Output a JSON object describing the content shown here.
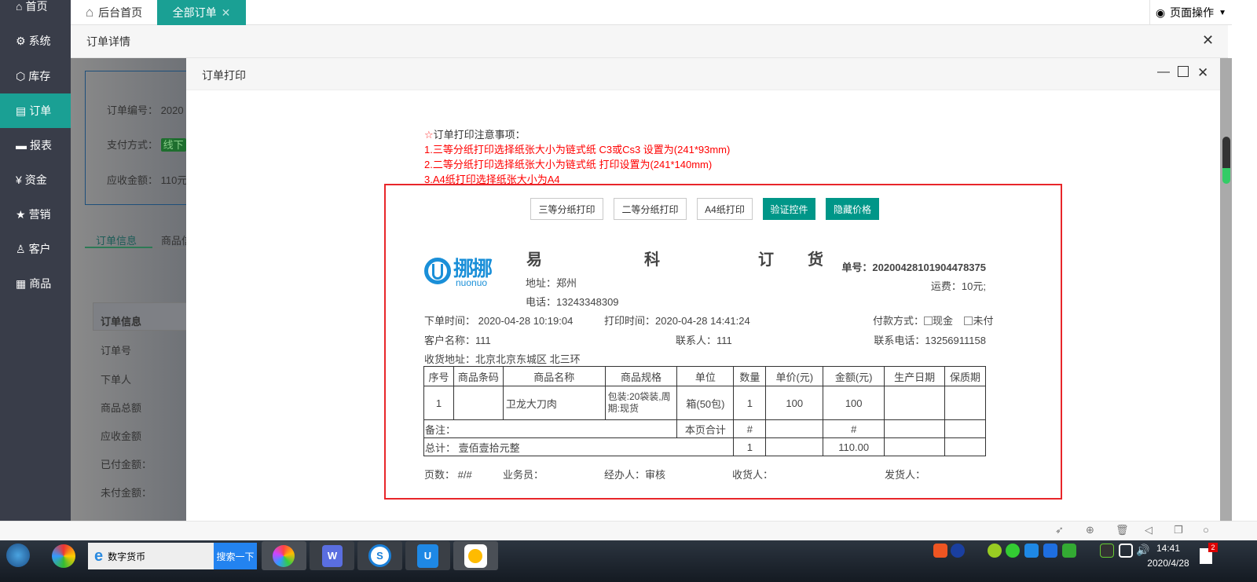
{
  "sidebar": {
    "items": [
      {
        "label": "首页",
        "icon": "home-icon"
      },
      {
        "label": "系统",
        "icon": "gear-icon"
      },
      {
        "label": "库存",
        "icon": "cube-icon"
      },
      {
        "label": "订单",
        "icon": "document-icon",
        "active": true
      },
      {
        "label": "报表",
        "icon": "monitor-icon"
      },
      {
        "label": "资金",
        "icon": "yen-icon"
      },
      {
        "label": "营销",
        "icon": "star-icon"
      },
      {
        "label": "客户",
        "icon": "user-icon"
      },
      {
        "label": "商品",
        "icon": "grid-icon"
      }
    ]
  },
  "tabs": [
    {
      "label": "后台首页"
    },
    {
      "label": "全部订单",
      "active": true
    }
  ],
  "page_ops": "页面操作",
  "subheader": "订单详情",
  "background": {
    "order_no_label": "订单编号：",
    "order_no": "2020",
    "pay_label": "支付方式：",
    "pay_badge": "线下",
    "due_label": "应收金额：",
    "due": "110元",
    "tab1": "订单信息",
    "tab2": "商品信",
    "table": [
      "订单信息",
      "订单号",
      "下单人",
      "商品总额",
      "应收金额",
      "已付金额：",
      "未付金额："
    ]
  },
  "modal": {
    "title": "订单打印"
  },
  "notes": {
    "head": "订单打印注意事项：",
    "lines": [
      "1.三等分纸打印选择纸张大小为链式纸 C3或Cs3 设置为(241*93mm)",
      "2.二等分纸打印选择纸张大小为链式纸 打印设置为(241*140mm)",
      "3.A4纸打印选择纸张大小为A4"
    ]
  },
  "buttons": {
    "third": "三等分纸打印",
    "half": "二等分纸打印",
    "a4": "A4纸打印",
    "verify": "验证控件",
    "hide_price": "隐藏价格"
  },
  "receipt": {
    "logo": "挪挪 nuonuo",
    "title": [
      "易",
      "科",
      "订",
      "货"
    ],
    "order_no": "单号：20200428101904478375",
    "shipping": "运费：10元;",
    "address": "地址：郑州",
    "phone": "电话：13243348309",
    "order_time": "下单时间： 2020-04-28 10:19:04",
    "print_time": "打印时间：2020-04-28 14:41:24",
    "pay_method": "付款方式：",
    "pay_cash": "现金",
    "pay_unpaid": "未付",
    "customer": "客户名称：111",
    "contact": "联系人：111",
    "contact_phone": "联系电话：13256911158",
    "ship_address": "收货地址：北京北京东城区 北三环",
    "headers": [
      "序号",
      "商品条码",
      "商品名称",
      "商品规格",
      "单位",
      "数量",
      "单价(元)",
      "金额(元)",
      "生产日期",
      "保质期"
    ],
    "rows": [
      [
        "1",
        "",
        "卫龙大刀肉",
        "包装:20袋装,周期:现货",
        "箱(50包)",
        "1",
        "100",
        "100",
        "",
        ""
      ]
    ],
    "remark": "备注：",
    "page_total_label": "本页合计",
    "page_qty": "#",
    "page_amount": "#",
    "total_label": "总计：  壹佰壹拾元整",
    "total_qty": "1",
    "total_amount": "110.00",
    "footer": [
      "页数：  #/#",
      "业务员：",
      "经办人：审核",
      "收货人：",
      "发货人："
    ]
  },
  "taskbar": {
    "search_value": "数字货币",
    "search_button": "搜索一下",
    "time": "14:41",
    "date": "2020/4/28",
    "notify_count": "2"
  }
}
